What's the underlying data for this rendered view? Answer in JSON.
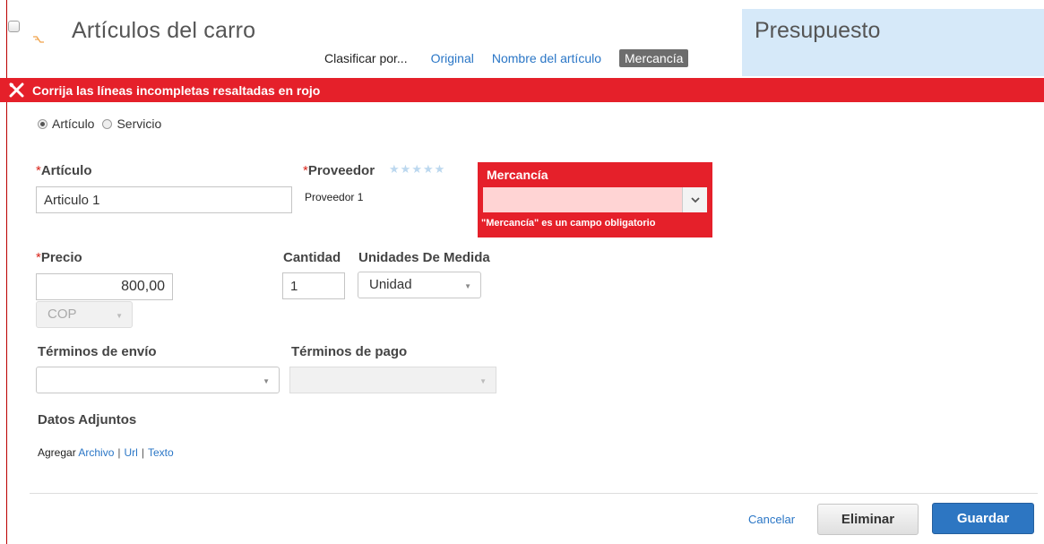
{
  "header": {
    "title": "Artículos del carro",
    "sort": {
      "label": "Clasificar por...",
      "options": [
        "Original",
        "Nombre del artículo"
      ],
      "active": "Mercancía"
    }
  },
  "budget": {
    "title": "Presupuesto"
  },
  "error_banner": {
    "message": "Corrija las líneas incompletas resaltadas en rojo",
    "color": "#e5202a"
  },
  "type_options": {
    "item": "Artículo",
    "service": "Servicio",
    "selected": "Artículo"
  },
  "form": {
    "required_marker": "*",
    "item": {
      "label": "Artículo",
      "value": "Articulo 1"
    },
    "supplier": {
      "label": "Proveedor",
      "value": "Proveedor 1",
      "rating_icon": "star-icon"
    },
    "commodity": {
      "label": "Mercancía",
      "value": "",
      "error": "\"Mercancía\" es un campo obligatorio"
    },
    "price": {
      "label": "Precio",
      "value": "800,00",
      "currency": "COP"
    },
    "quantity": {
      "label": "Cantidad",
      "value": "1"
    },
    "uom": {
      "label": "Unidades De Medida",
      "value": "Unidad"
    },
    "shipping_terms": {
      "label": "Términos de envío",
      "value": ""
    },
    "payment_terms": {
      "label": "Términos de pago",
      "value": ""
    },
    "attachments": {
      "label": "Datos Adjuntos",
      "prefix": "Agregar",
      "links": [
        "Archivo",
        "Url",
        "Texto"
      ],
      "separator": "|"
    }
  },
  "actions": {
    "cancel": "Cancelar",
    "delete": "Eliminar",
    "save": "Guardar"
  },
  "colors": {
    "link": "#2a76c6",
    "primary_button": "#2d76c2",
    "budget_panel": "#d6e9f9"
  }
}
